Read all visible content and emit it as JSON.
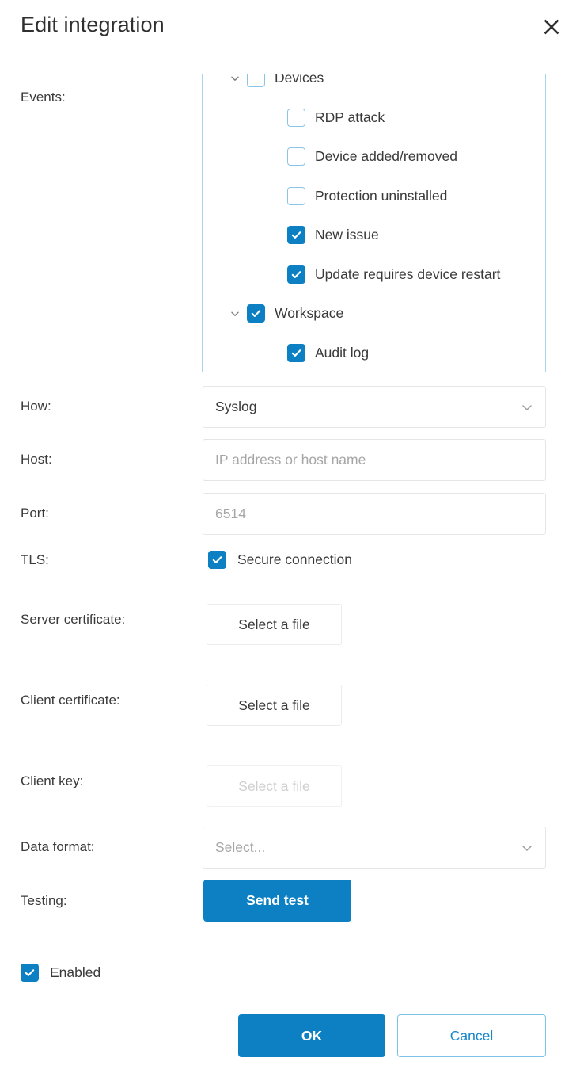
{
  "dialog": {
    "title": "Edit integration",
    "close_icon": "close-icon"
  },
  "labels": {
    "events": "Events:",
    "how": "How:",
    "host": "Host:",
    "port": "Port:",
    "tls": "TLS:",
    "server_certificate": "Server certificate:",
    "client_certificate": "Client certificate:",
    "client_key": "Client key:",
    "data_format": "Data format:",
    "testing": "Testing:"
  },
  "events_tree": [
    {
      "label": "Devices",
      "level": 0,
      "checked": false,
      "expanded": true,
      "chevron": "chevron-down-icon",
      "clipped": true
    },
    {
      "label": "RDP attack",
      "level": 1,
      "checked": false,
      "expanded": null,
      "chevron": ""
    },
    {
      "label": "Device added/removed",
      "level": 1,
      "checked": false,
      "expanded": null,
      "chevron": ""
    },
    {
      "label": "Protection uninstalled",
      "level": 1,
      "checked": false,
      "expanded": null,
      "chevron": ""
    },
    {
      "label": "New issue",
      "level": 1,
      "checked": true,
      "expanded": null,
      "chevron": ""
    },
    {
      "label": "Update requires device restart",
      "level": 1,
      "checked": true,
      "expanded": null,
      "chevron": ""
    },
    {
      "label": "Workspace",
      "level": 0,
      "checked": true,
      "expanded": true,
      "chevron": "chevron-down-icon"
    },
    {
      "label": "Audit log",
      "level": 1,
      "checked": true,
      "expanded": null,
      "chevron": ""
    }
  ],
  "fields": {
    "how": {
      "value": "Syslog",
      "caret_icon": "chevron-down-icon"
    },
    "host": {
      "value": "",
      "placeholder": "IP address or host name"
    },
    "port": {
      "value": "",
      "placeholder": "6514"
    },
    "data_format": {
      "value": "",
      "placeholder": "Select...",
      "caret_icon": "chevron-down-icon"
    }
  },
  "tls": {
    "checkbox_label": "Secure connection",
    "checked": true
  },
  "files": {
    "server_certificate_button": "Select a file",
    "client_certificate_button": "Select a file",
    "client_key_button": "Select a file",
    "client_key_disabled": true
  },
  "testing": {
    "send_test_label": "Send test"
  },
  "enabled": {
    "label": "Enabled",
    "checked": true
  },
  "footer": {
    "ok_label": "OK",
    "cancel_label": "Cancel"
  },
  "colors": {
    "accent": "#0c80c3",
    "accent_light_border": "#7cc3e8",
    "checkbox_off_border": "#89c5e6",
    "events_box_border": "#a7d5ee",
    "text": "#3a3a3a",
    "placeholder": "#a6a6a6",
    "disabled_text": "#cfcfcf",
    "field_border": "#e6e6e6"
  }
}
